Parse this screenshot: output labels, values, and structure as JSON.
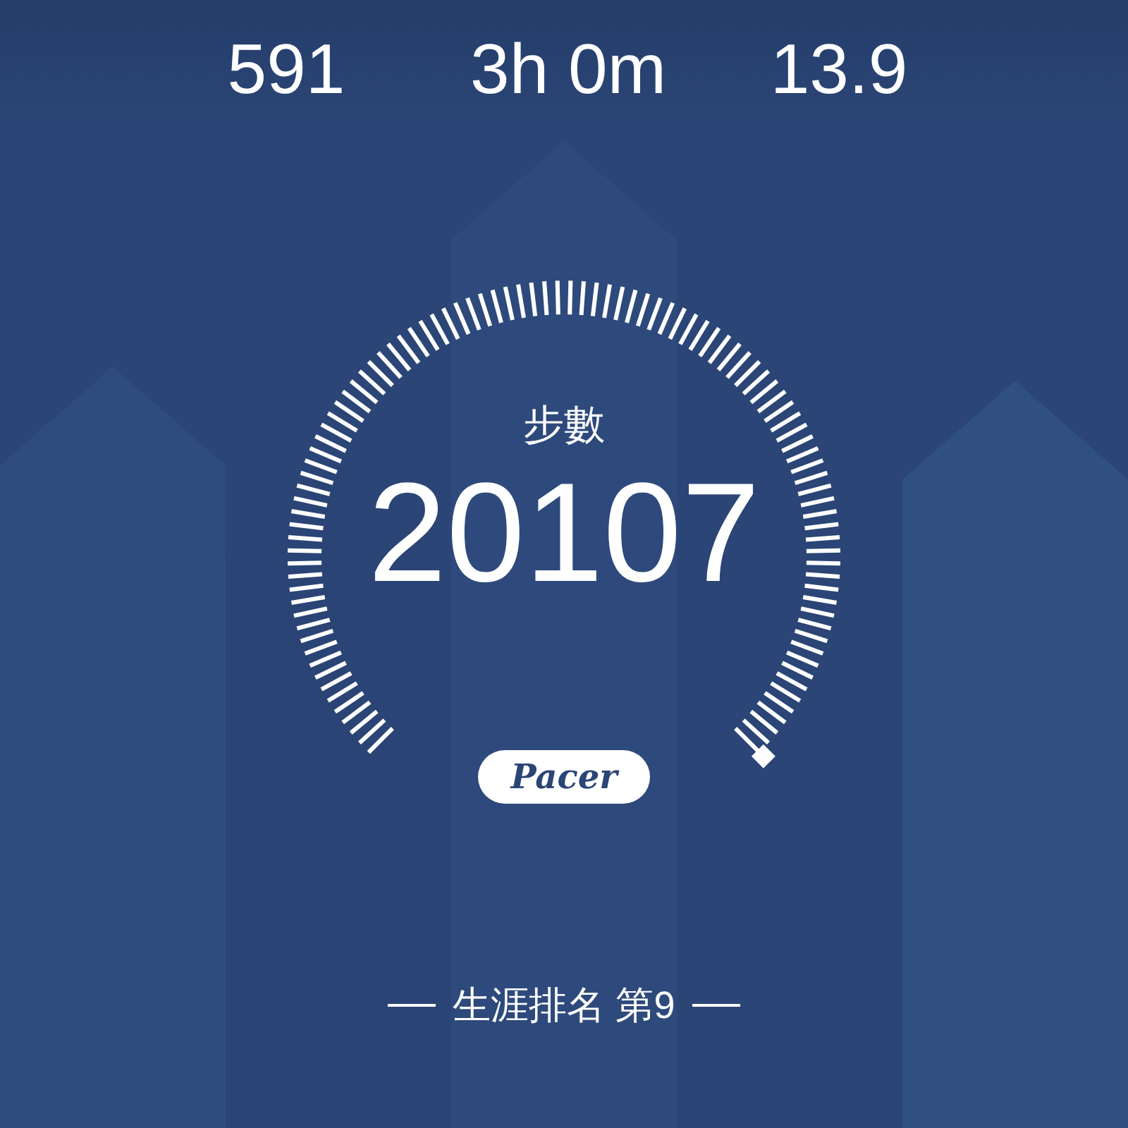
{
  "stats": [
    {
      "value": "591"
    },
    {
      "value": "3h 0m"
    },
    {
      "value": "13.9"
    }
  ],
  "gauge": {
    "label": "步數",
    "value": "20107",
    "logo": "Pacer"
  },
  "ranking": {
    "text": "生涯排名 第9"
  }
}
